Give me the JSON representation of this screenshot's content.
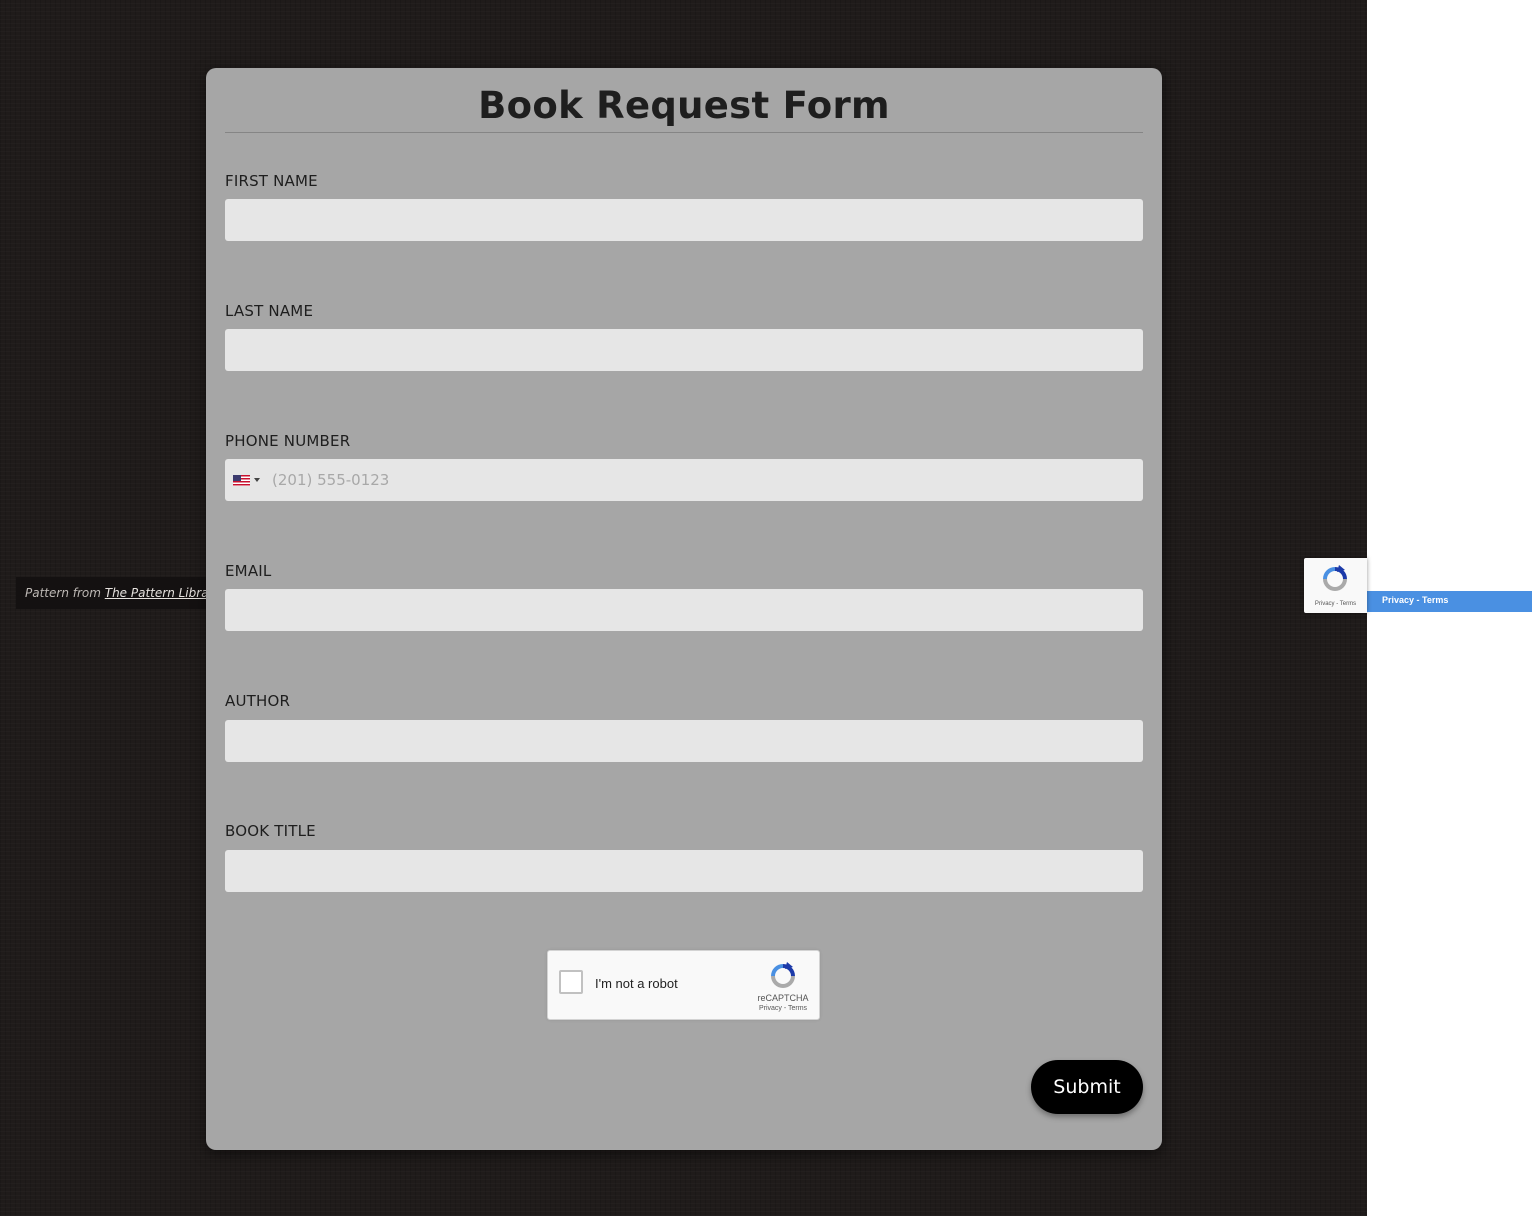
{
  "pattern_credit": {
    "prefix": "Pattern from ",
    "link_text": "The Pattern Library"
  },
  "form": {
    "title": "Book Request Form",
    "fields": {
      "first_name": {
        "label": "FIRST NAME",
        "value": "",
        "placeholder": ""
      },
      "last_name": {
        "label": "LAST NAME",
        "value": "",
        "placeholder": ""
      },
      "phone": {
        "label": "PHONE NUMBER",
        "value": "",
        "placeholder": "(201) 555-0123",
        "country_icon": "us-flag-icon"
      },
      "email": {
        "label": "EMAIL",
        "value": "",
        "placeholder": ""
      },
      "author": {
        "label": "AUTHOR",
        "value": "",
        "placeholder": ""
      },
      "book_title": {
        "label": "BOOK TITLE",
        "value": "",
        "placeholder": ""
      }
    },
    "submit_label": "Submit"
  },
  "recaptcha": {
    "label": "I'm not a robot",
    "brand": "reCAPTCHA",
    "links": "Privacy - Terms"
  },
  "recaptcha_badge": {
    "links": "Privacy - Terms",
    "bar_text": "Privacy - Terms"
  },
  "colors": {
    "page_background": "#1f1b1a",
    "card_background": "#a6a6a6",
    "input_background": "#e6e6e6",
    "submit_background": "#000000",
    "badge_bar": "#4a90e2"
  }
}
